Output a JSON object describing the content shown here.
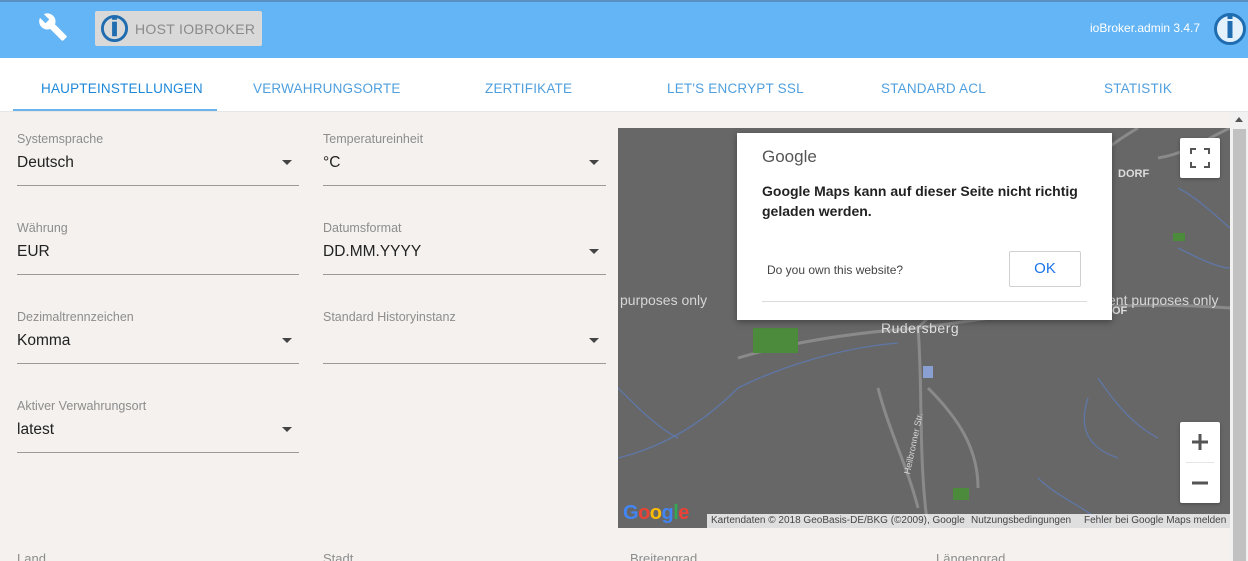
{
  "header": {
    "host_label": "HOST IOBROKER",
    "version": "ioBroker.admin 3.4.7"
  },
  "tabs": [
    {
      "label": "HAUPTEINSTELLUNGEN",
      "active": true
    },
    {
      "label": "VERWAHRUNGSORTE"
    },
    {
      "label": "ZERTIFIKATE"
    },
    {
      "label": "LET'S ENCRYPT SSL"
    },
    {
      "label": "STANDARD ACL"
    },
    {
      "label": "STATISTIK"
    }
  ],
  "form": {
    "systemsprache": {
      "label": "Systemsprache",
      "value": "Deutsch"
    },
    "temperatureinheit": {
      "label": "Temperatureinheit",
      "value": "°C"
    },
    "waehrung": {
      "label": "Währung",
      "value": "EUR"
    },
    "datumsformat": {
      "label": "Datumsformat",
      "value": "DD.MM.YYYY"
    },
    "dezimaltrennzeichen": {
      "label": "Dezimaltrennzeichen",
      "value": "Komma"
    },
    "historyinstanz": {
      "label": "Standard Historyinstanz",
      "value": ""
    },
    "verwahrungsort": {
      "label": "Aktiver Verwahrungsort",
      "value": "latest"
    },
    "land": {
      "label": "Land"
    },
    "stadt": {
      "label": "Stadt"
    },
    "breitengrad": {
      "label": "Breitengrad"
    },
    "laengengrad": {
      "label": "Längengrad"
    }
  },
  "map": {
    "dev_text_left": "purposes only",
    "dev_text_right": "ent purposes only",
    "town": "Rudersberg",
    "town_partial": "DORF",
    "of_partial": "OF",
    "street": "Heilbronner Str.",
    "logo_text": "Google",
    "attribution": "Kartendaten © 2018 GeoBasis-DE/BKG (©2009), Google",
    "terms": "Nutzungsbedingungen",
    "report": "Fehler bei Google Maps melden"
  },
  "dialog": {
    "brand": "Google",
    "message": "Google Maps kann auf dieser Seite nicht richtig geladen werden.",
    "question": "Do you own this website?",
    "ok_label": "OK"
  },
  "colors": {
    "header_bg": "#64b5f6",
    "tab_text": "#4f9fde",
    "page_bg": "#f4f1ee",
    "map_bg": "#676767"
  }
}
